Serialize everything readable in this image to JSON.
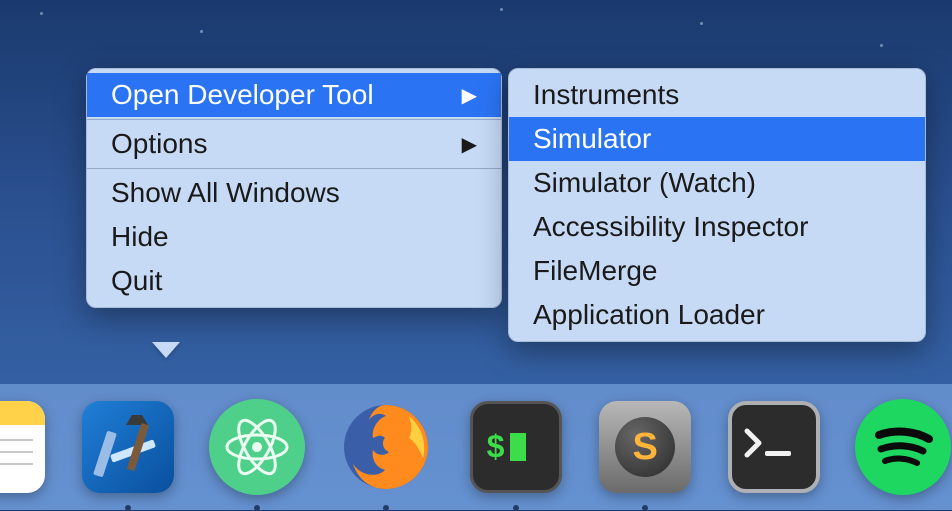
{
  "context_menu": {
    "items": [
      {
        "label": "Open Developer Tool",
        "has_submenu": true,
        "selected": true
      },
      {
        "label": "Options",
        "has_submenu": true,
        "selected": false
      },
      {
        "label": "Show All Windows",
        "has_submenu": false,
        "selected": false
      },
      {
        "label": "Hide",
        "has_submenu": false,
        "selected": false
      },
      {
        "label": "Quit",
        "has_submenu": false,
        "selected": false
      }
    ],
    "arrow_glyph": "▶"
  },
  "submenu": {
    "items": [
      {
        "label": "Instruments",
        "selected": false
      },
      {
        "label": "Simulator",
        "selected": true
      },
      {
        "label": "Simulator (Watch)",
        "selected": false
      },
      {
        "label": "Accessibility Inspector",
        "selected": false
      },
      {
        "label": "FileMerge",
        "selected": false
      },
      {
        "label": "Application Loader",
        "selected": false
      }
    ]
  },
  "dock": {
    "items": [
      {
        "name": "notes",
        "running": false
      },
      {
        "name": "xcode",
        "running": true
      },
      {
        "name": "atom",
        "running": true
      },
      {
        "name": "firefox",
        "running": true
      },
      {
        "name": "iterm",
        "running": true
      },
      {
        "name": "sublime-text",
        "running": true
      },
      {
        "name": "terminal",
        "running": false
      },
      {
        "name": "spotify",
        "running": false
      }
    ]
  }
}
